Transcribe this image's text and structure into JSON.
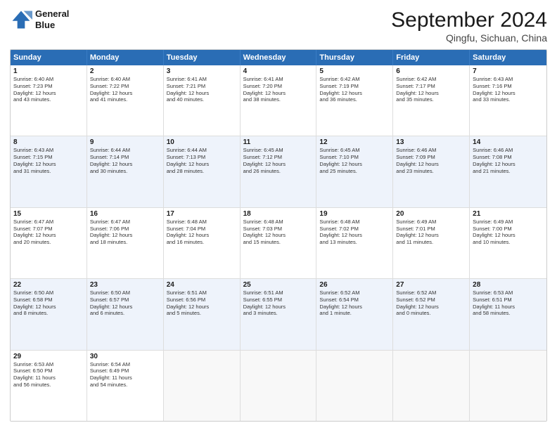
{
  "logo": {
    "line1": "General",
    "line2": "Blue"
  },
  "title": "September 2024",
  "location": "Qingfu, Sichuan, China",
  "header_days": [
    "Sunday",
    "Monday",
    "Tuesday",
    "Wednesday",
    "Thursday",
    "Friday",
    "Saturday"
  ],
  "rows": [
    {
      "alt": false,
      "cells": [
        {
          "day": "1",
          "detail": "Sunrise: 6:40 AM\nSunset: 7:23 PM\nDaylight: 12 hours\nand 43 minutes."
        },
        {
          "day": "2",
          "detail": "Sunrise: 6:40 AM\nSunset: 7:22 PM\nDaylight: 12 hours\nand 41 minutes."
        },
        {
          "day": "3",
          "detail": "Sunrise: 6:41 AM\nSunset: 7:21 PM\nDaylight: 12 hours\nand 40 minutes."
        },
        {
          "day": "4",
          "detail": "Sunrise: 6:41 AM\nSunset: 7:20 PM\nDaylight: 12 hours\nand 38 minutes."
        },
        {
          "day": "5",
          "detail": "Sunrise: 6:42 AM\nSunset: 7:19 PM\nDaylight: 12 hours\nand 36 minutes."
        },
        {
          "day": "6",
          "detail": "Sunrise: 6:42 AM\nSunset: 7:17 PM\nDaylight: 12 hours\nand 35 minutes."
        },
        {
          "day": "7",
          "detail": "Sunrise: 6:43 AM\nSunset: 7:16 PM\nDaylight: 12 hours\nand 33 minutes."
        }
      ]
    },
    {
      "alt": true,
      "cells": [
        {
          "day": "8",
          "detail": "Sunrise: 6:43 AM\nSunset: 7:15 PM\nDaylight: 12 hours\nand 31 minutes."
        },
        {
          "day": "9",
          "detail": "Sunrise: 6:44 AM\nSunset: 7:14 PM\nDaylight: 12 hours\nand 30 minutes."
        },
        {
          "day": "10",
          "detail": "Sunrise: 6:44 AM\nSunset: 7:13 PM\nDaylight: 12 hours\nand 28 minutes."
        },
        {
          "day": "11",
          "detail": "Sunrise: 6:45 AM\nSunset: 7:12 PM\nDaylight: 12 hours\nand 26 minutes."
        },
        {
          "day": "12",
          "detail": "Sunrise: 6:45 AM\nSunset: 7:10 PM\nDaylight: 12 hours\nand 25 minutes."
        },
        {
          "day": "13",
          "detail": "Sunrise: 6:46 AM\nSunset: 7:09 PM\nDaylight: 12 hours\nand 23 minutes."
        },
        {
          "day": "14",
          "detail": "Sunrise: 6:46 AM\nSunset: 7:08 PM\nDaylight: 12 hours\nand 21 minutes."
        }
      ]
    },
    {
      "alt": false,
      "cells": [
        {
          "day": "15",
          "detail": "Sunrise: 6:47 AM\nSunset: 7:07 PM\nDaylight: 12 hours\nand 20 minutes."
        },
        {
          "day": "16",
          "detail": "Sunrise: 6:47 AM\nSunset: 7:06 PM\nDaylight: 12 hours\nand 18 minutes."
        },
        {
          "day": "17",
          "detail": "Sunrise: 6:48 AM\nSunset: 7:04 PM\nDaylight: 12 hours\nand 16 minutes."
        },
        {
          "day": "18",
          "detail": "Sunrise: 6:48 AM\nSunset: 7:03 PM\nDaylight: 12 hours\nand 15 minutes."
        },
        {
          "day": "19",
          "detail": "Sunrise: 6:48 AM\nSunset: 7:02 PM\nDaylight: 12 hours\nand 13 minutes."
        },
        {
          "day": "20",
          "detail": "Sunrise: 6:49 AM\nSunset: 7:01 PM\nDaylight: 12 hours\nand 11 minutes."
        },
        {
          "day": "21",
          "detail": "Sunrise: 6:49 AM\nSunset: 7:00 PM\nDaylight: 12 hours\nand 10 minutes."
        }
      ]
    },
    {
      "alt": true,
      "cells": [
        {
          "day": "22",
          "detail": "Sunrise: 6:50 AM\nSunset: 6:58 PM\nDaylight: 12 hours\nand 8 minutes."
        },
        {
          "day": "23",
          "detail": "Sunrise: 6:50 AM\nSunset: 6:57 PM\nDaylight: 12 hours\nand 6 minutes."
        },
        {
          "day": "24",
          "detail": "Sunrise: 6:51 AM\nSunset: 6:56 PM\nDaylight: 12 hours\nand 5 minutes."
        },
        {
          "day": "25",
          "detail": "Sunrise: 6:51 AM\nSunset: 6:55 PM\nDaylight: 12 hours\nand 3 minutes."
        },
        {
          "day": "26",
          "detail": "Sunrise: 6:52 AM\nSunset: 6:54 PM\nDaylight: 12 hours\nand 1 minute."
        },
        {
          "day": "27",
          "detail": "Sunrise: 6:52 AM\nSunset: 6:52 PM\nDaylight: 12 hours\nand 0 minutes."
        },
        {
          "day": "28",
          "detail": "Sunrise: 6:53 AM\nSunset: 6:51 PM\nDaylight: 11 hours\nand 58 minutes."
        }
      ]
    },
    {
      "alt": false,
      "cells": [
        {
          "day": "29",
          "detail": "Sunrise: 6:53 AM\nSunset: 6:50 PM\nDaylight: 11 hours\nand 56 minutes."
        },
        {
          "day": "30",
          "detail": "Sunrise: 6:54 AM\nSunset: 6:49 PM\nDaylight: 11 hours\nand 54 minutes."
        },
        {
          "day": "",
          "detail": "",
          "empty": true
        },
        {
          "day": "",
          "detail": "",
          "empty": true
        },
        {
          "day": "",
          "detail": "",
          "empty": true
        },
        {
          "day": "",
          "detail": "",
          "empty": true
        },
        {
          "day": "",
          "detail": "",
          "empty": true
        }
      ]
    }
  ]
}
